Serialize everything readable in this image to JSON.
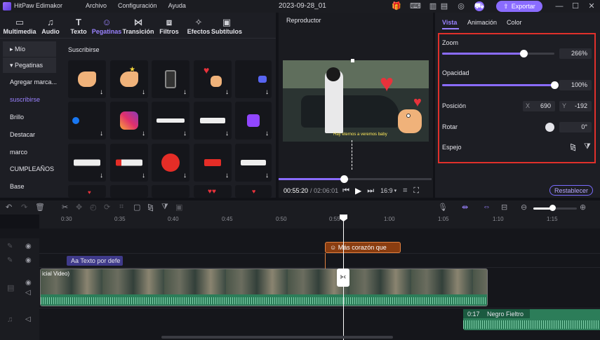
{
  "app": {
    "name": "HitPaw Edimakor",
    "project": "2023-09-28_01",
    "export_label": "Exportar"
  },
  "menu": [
    "Archivo",
    "Configuración",
    "Ayuda"
  ],
  "categories": [
    {
      "label": "Multimedia",
      "icon": "folder-icon"
    },
    {
      "label": "Audio",
      "icon": "music-note-icon"
    },
    {
      "label": "Texto",
      "icon": "text-icon"
    },
    {
      "label": "Pegatinas",
      "icon": "sticker-icon"
    },
    {
      "label": "Transición",
      "icon": "transition-icon"
    },
    {
      "label": "Filtros",
      "icon": "filter-icon"
    },
    {
      "label": "Efectos",
      "icon": "effects-wand-icon"
    },
    {
      "label": "Subtítulos",
      "icon": "subtitles-icon"
    }
  ],
  "sidebar": {
    "items": [
      "Mío",
      "Pegatinas",
      "Agregar marca...",
      "suscribirse",
      "Brillo",
      "Destacar",
      "marco",
      "CUMPLEAÑOS",
      "Base"
    ],
    "mine_header": "▸ Mío",
    "stickers_header": "▾ Pegatinas"
  },
  "stickers": {
    "section_title": "Suscribirse"
  },
  "player": {
    "label": "Reproductor",
    "current_time": "00:55:20",
    "total_time": "/ 02:06:01",
    "aspect": "16:9",
    "caption": "Hay eternos a veremos baby",
    "progress": 0.43
  },
  "props": {
    "tabs": [
      "Vista",
      "Animación",
      "Color"
    ],
    "zoom": {
      "label": "Zoom",
      "value": "266%",
      "level": 0.73
    },
    "opacity": {
      "label": "Opacidad",
      "value": "100%",
      "level": 1.0
    },
    "position": {
      "label": "Posición",
      "x_label": "X",
      "x": "690",
      "y_label": "Y",
      "y": "-192"
    },
    "rotate": {
      "label": "Rotar",
      "value": "0°"
    },
    "mirror": {
      "label": "Espejo"
    },
    "reset_label": "Restablecer"
  },
  "ruler": [
    "0:30",
    "0:35",
    "0:40",
    "0:45",
    "0:50",
    "0:55",
    "1:00",
    "1:05",
    "1:10",
    "1:15"
  ],
  "timeline": {
    "text_clip": "Texto por defe",
    "sticker_clip": "Más corazón que",
    "video_clip_label": "icial Video)",
    "audio_time": "0:17",
    "audio_name": "Negro Fieltro"
  },
  "colors": {
    "accent": "#8a6cff",
    "highlight": "#e0302b",
    "audio": "#2c7d59"
  }
}
